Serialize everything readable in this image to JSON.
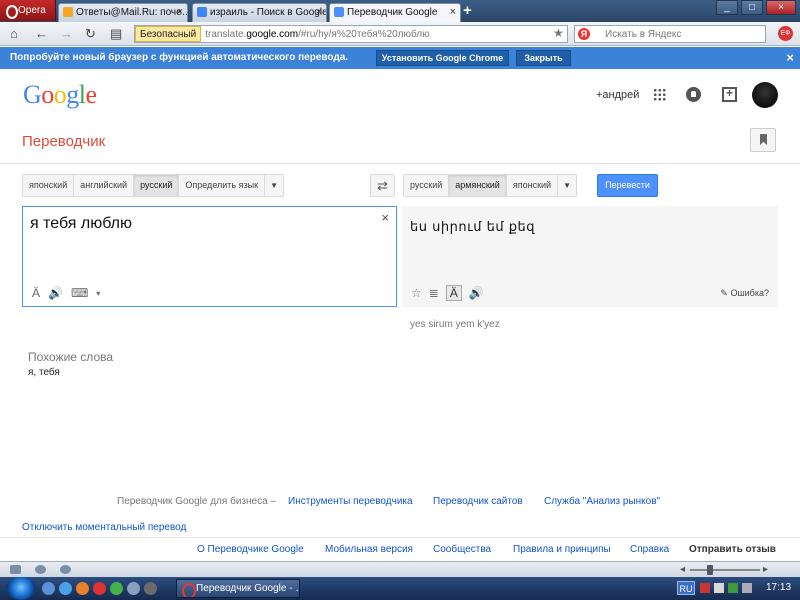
{
  "browser": {
    "opera_label": "Opera",
    "tabs": [
      {
        "label": "Ответы@Mail.Ru: поче…",
        "fav_color": "#f5a623"
      },
      {
        "label": "израиль - Поиск в Google",
        "fav_color": "#4285f4"
      },
      {
        "label": "Переводчик Google",
        "fav_color": "#4d90fe"
      }
    ],
    "new_tab": "+",
    "address": {
      "security": "Безопасный",
      "url_prefix": "translate.",
      "url_host": "google.com",
      "url_rest": "/#ru/hy/я%20тебя%20люблю"
    },
    "search_placeholder": "Искать в Яндекс",
    "search_engine_badge": "Я",
    "extension_label": "ЕФ"
  },
  "promo": {
    "text": "Попробуйте новый браузер с функцией автоматического перевода.",
    "install_label": "Установить Google Chrome",
    "close_label": "Закрыть",
    "dismiss": "×"
  },
  "header": {
    "logo": [
      "G",
      "o",
      "o",
      "g",
      "l",
      "e"
    ],
    "logo_colors": [
      "#4285f4",
      "#ea4335",
      "#fbbc05",
      "#4285f4",
      "#34a853",
      "#ea4335"
    ],
    "user": "+андрей"
  },
  "page": {
    "title": "Переводчик"
  },
  "source_langs": [
    "японский",
    "английский",
    "русский",
    "Определить язык"
  ],
  "source_selected": 2,
  "target_langs": [
    "русский",
    "армянский",
    "японский"
  ],
  "target_selected": 1,
  "swap_icon": "⇄",
  "translate_label": "Перевести",
  "source": {
    "text": "я тебя люблю",
    "clear": "×",
    "tools": [
      "Ä",
      "🔊",
      "⌨",
      "▾"
    ]
  },
  "result": {
    "text": "ես սիրում եմ քեզ",
    "tools": [
      "☆",
      "≣",
      "Ä",
      "🔊"
    ],
    "error_label": "Ошибка?",
    "transliteration": "yes sirum yem k'yez"
  },
  "similar": {
    "heading": "Похожие слова",
    "words": "я, тебя"
  },
  "footer": {
    "business_prefix": "Переводчик Google для бизнеса –",
    "business_links": [
      "Инструменты переводчика",
      "Переводчик сайтов",
      "Служба \"Анализ рынков\""
    ],
    "instant_off": "Отключить моментальный перевод",
    "links": [
      "О Переводчике Google",
      "Мобильная версия",
      "Сообщества",
      "Правила и принципы",
      "Справка"
    ],
    "feedback": "Отправить отзыв"
  },
  "taskbar": {
    "task_label": "Переводчик Google - …",
    "lang": "RU",
    "time": "17:13"
  }
}
